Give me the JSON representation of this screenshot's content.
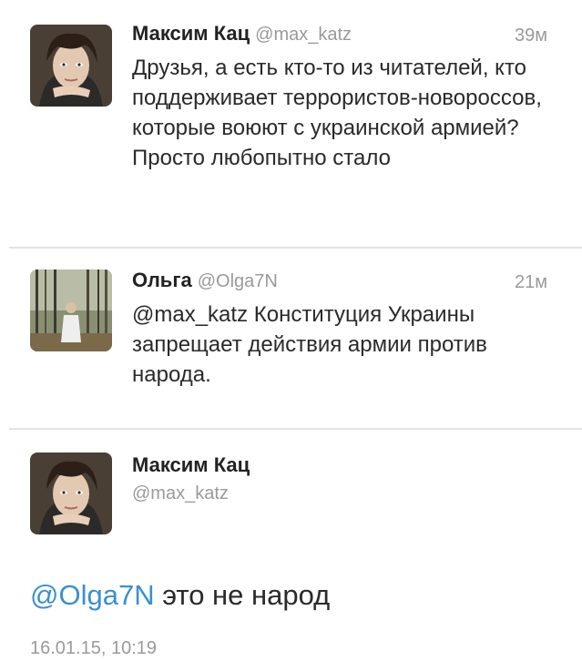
{
  "tweets": [
    {
      "name": "Максим Кац",
      "handle": "@max_katz",
      "time": "39м",
      "text": "Друзья, а есть кто-то из читателей, кто поддерживает террористов-новороссов, которые воюют с украинской армией? Просто любопытно стало"
    },
    {
      "name": "Ольга",
      "handle": "@Olga7N",
      "time": "21м",
      "text": "@max_katz Конституция Украины запрещает действия армии против народа."
    }
  ],
  "detail": {
    "name": "Максим Кац",
    "handle": "@max_katz",
    "mention": "@Olga7N",
    "text": " это не народ",
    "date": "16.01.15, 10:19"
  },
  "colors": {
    "mention": "#3b8fd0",
    "secondary_text": "#9a9a9a",
    "divider": "#e3e3e3"
  }
}
